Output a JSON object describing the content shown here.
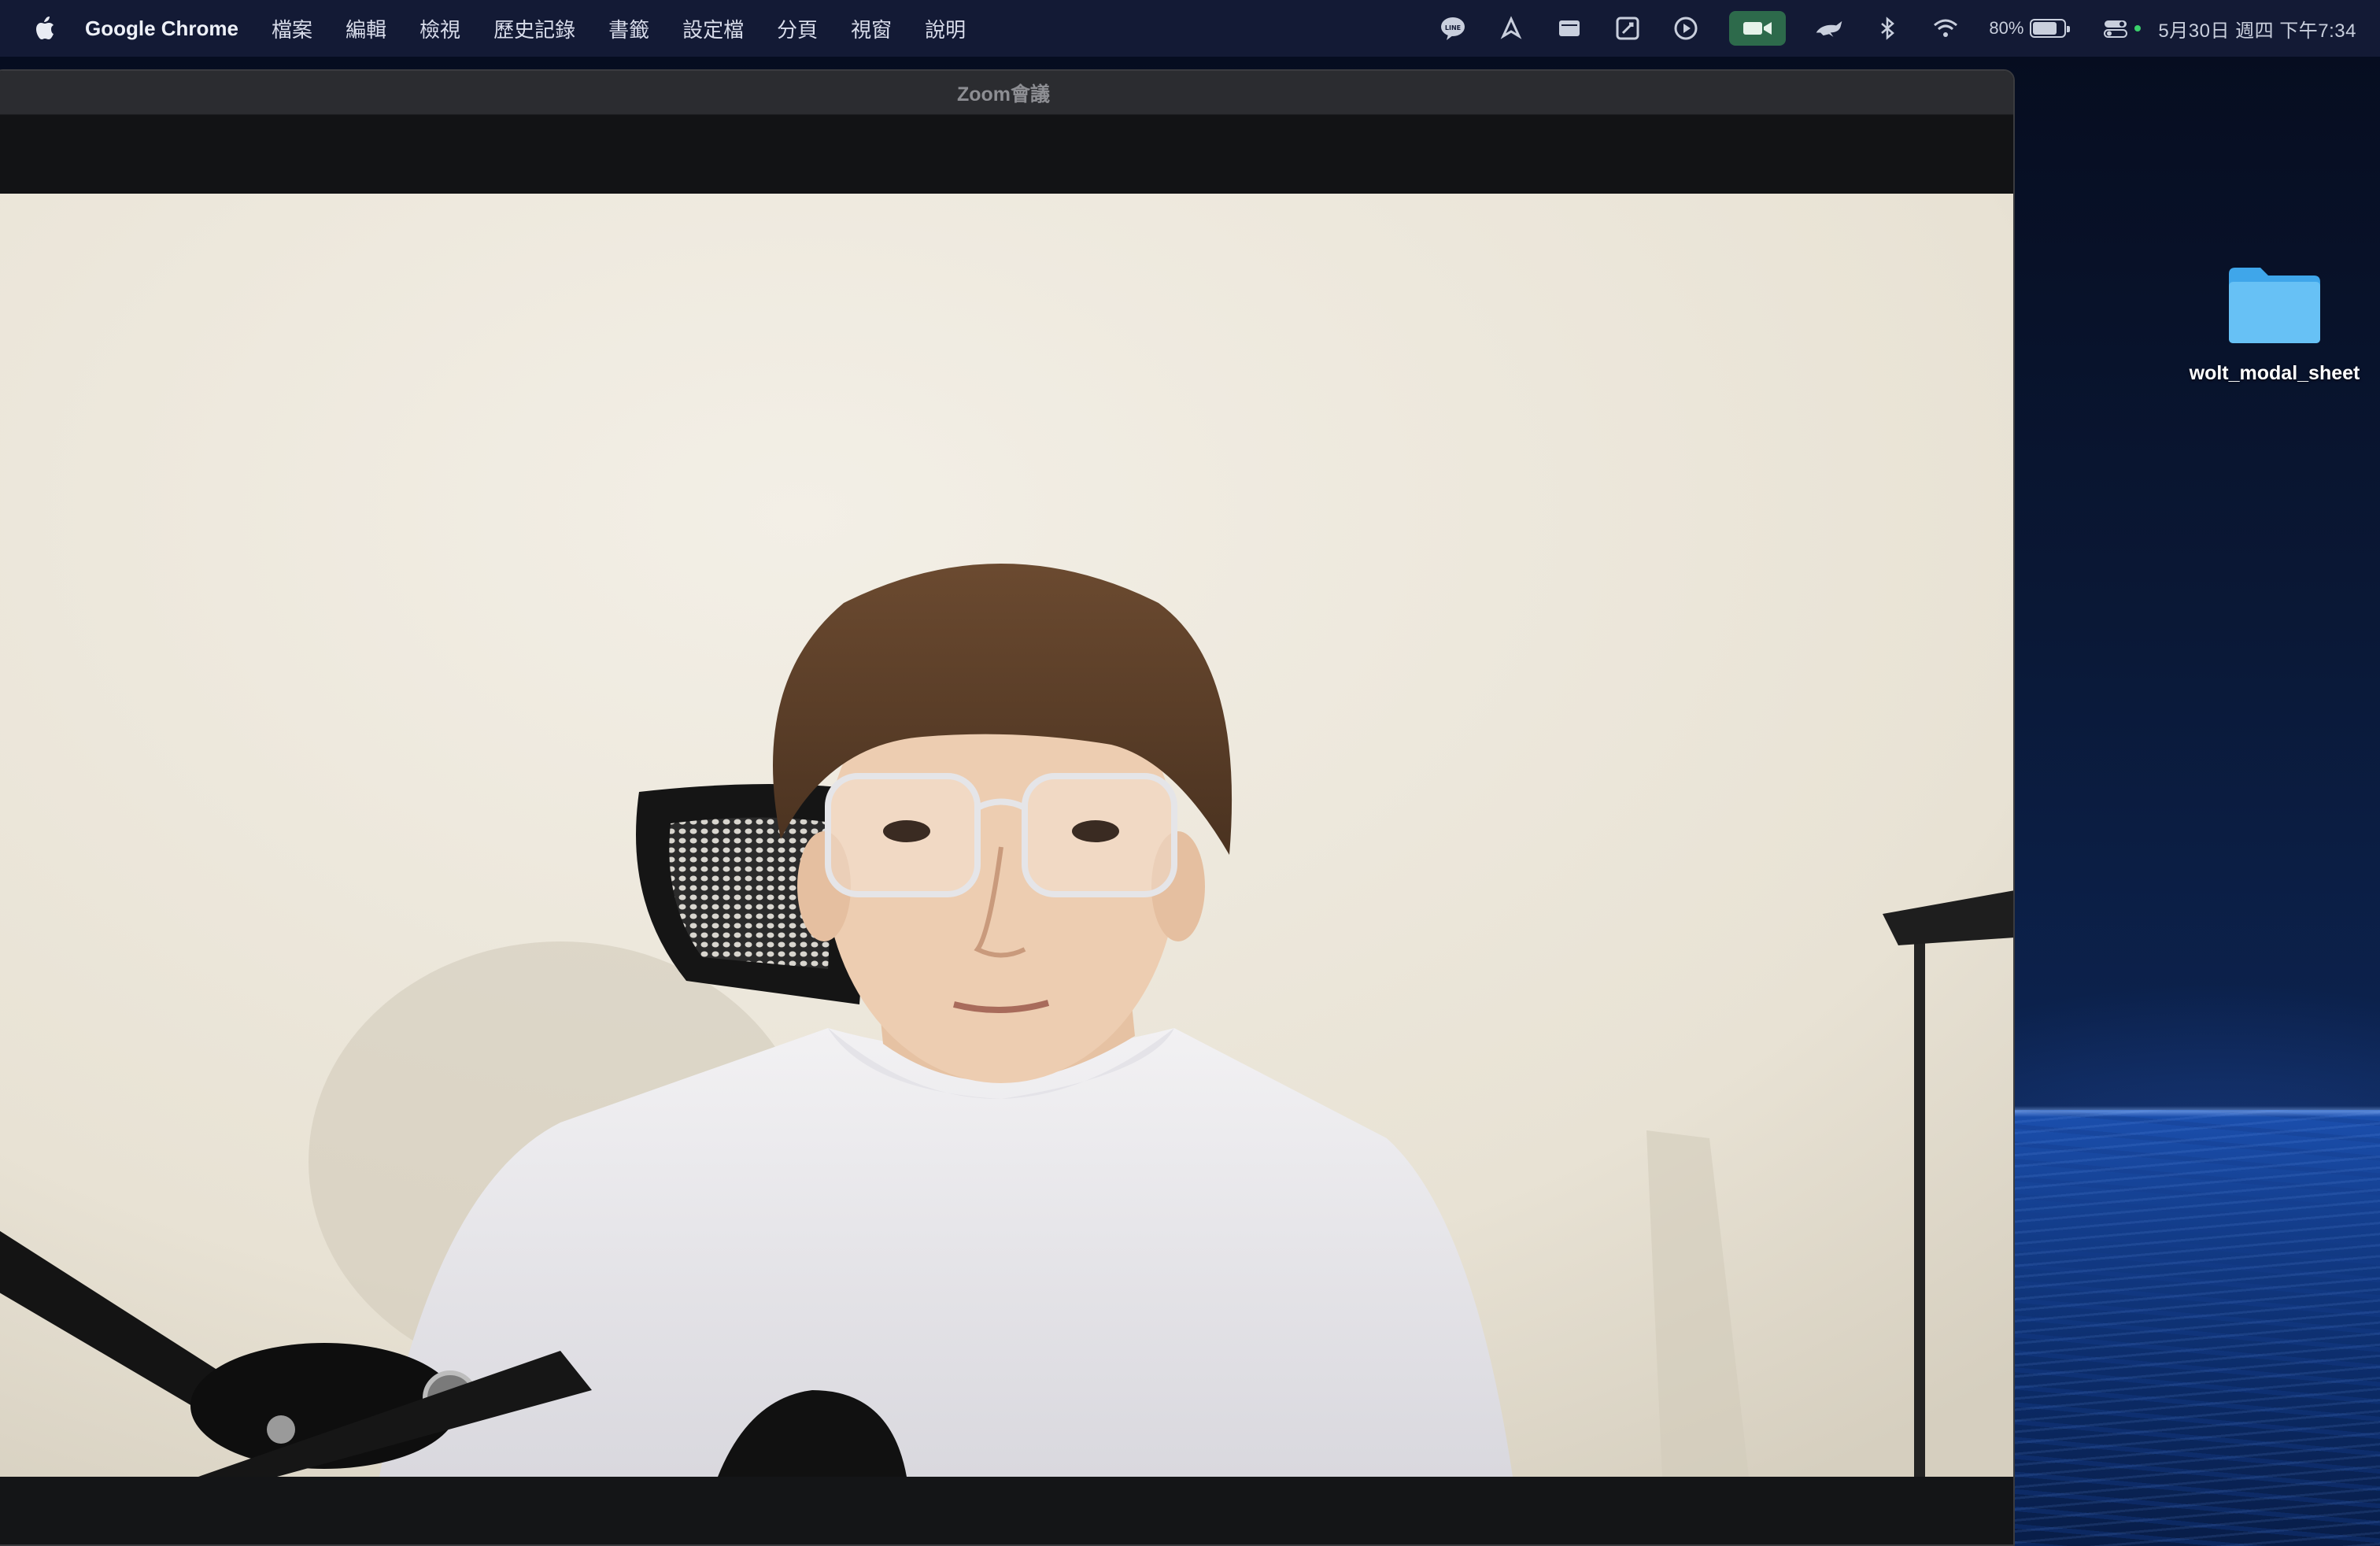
{
  "menubar": {
    "app_name": "Google Chrome",
    "items": [
      "檔案",
      "編輯",
      "檢視",
      "歷史記錄",
      "書籤",
      "設定檔",
      "分頁",
      "視窗",
      "說明"
    ],
    "battery_percent": "80%",
    "battery_level": 0.8,
    "clock": "5月30日 週四  下午7:34",
    "status_icons": [
      "line-icon",
      "pen-icon",
      "display-icon",
      "screenshot-icon",
      "play-icon",
      "zoom-video-icon",
      "runcat-icon",
      "bluetooth-icon",
      "wifi-icon",
      "battery-icon",
      "control-center-icon"
    ]
  },
  "zoom_window": {
    "title": "Zoom會議",
    "colors": {
      "titlebar": "#2b2c30",
      "background": "#111214"
    }
  },
  "desktop": {
    "folder_label": "wolt_modal_sheet"
  }
}
